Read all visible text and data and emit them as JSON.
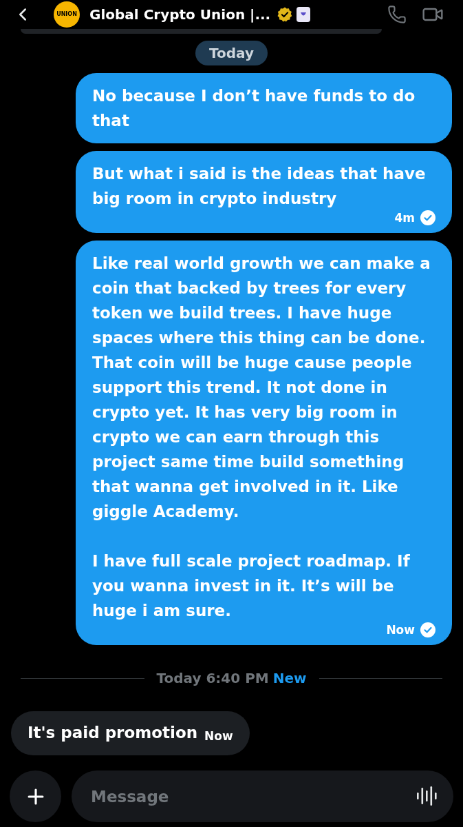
{
  "header": {
    "title": "Global Crypto Union |...",
    "logo_text": "UNION"
  },
  "thread": [
    {
      "kind": "date_chip",
      "text": "Today"
    },
    {
      "kind": "sent",
      "text": "No because I don’t have funds to do that",
      "read": false
    },
    {
      "kind": "sent",
      "text": "But what i said is the ideas that have big room in crypto industry",
      "time": "4m",
      "read": true
    },
    {
      "kind": "sent",
      "text": "Like real world growth we can make a coin that backed by trees for every token we build trees. I have huge spaces where this thing can be done. That coin will be huge cause people support this trend. It not done in crypto yet. It has very big room in crypto we can earn through this project same time build something that wanna get involved in it. Like giggle Academy.\n\nI have full scale project roadmap. If you wanna invest in it. It’s will be huge i am sure.",
      "time": "Now",
      "read": true
    },
    {
      "kind": "divider",
      "label": "Today 6:40 PM",
      "badge": "New"
    },
    {
      "kind": "received",
      "text": "It's paid promotion",
      "time": "Now",
      "read": false
    }
  ],
  "composer": {
    "placeholder": "Message"
  }
}
